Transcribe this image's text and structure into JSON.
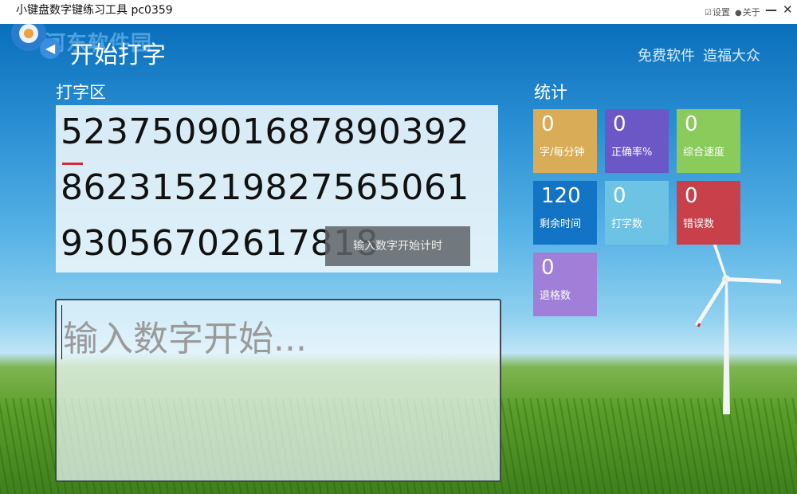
{
  "window": {
    "title": "小键盘数字键练习工具 pc0359",
    "settings_label": "设置",
    "about_label": "关于",
    "minimize_glyph": "—",
    "close_glyph": "✕"
  },
  "watermark": {
    "text": "河东软件园"
  },
  "header": {
    "back_icon": "arrow-left-icon",
    "title": "开始打字",
    "slogan_a": "免费软件",
    "slogan_b": "造福大众"
  },
  "typing_area": {
    "label": "打字区",
    "lines": [
      "5237509016878903​92",
      "862315219827565061",
      "930567026178​18"
    ],
    "tooltip": "输入数字开始计时"
  },
  "input": {
    "placeholder": "输入数字开始..."
  },
  "stats": {
    "label": "统计",
    "tiles": [
      {
        "value": "0",
        "label": "字/每分钟",
        "color": "#d9ad57"
      },
      {
        "value": "0",
        "label": "正确率%",
        "color": "#6c57c6"
      },
      {
        "value": "0",
        "label": "综合速度",
        "color": "#8acb5c"
      },
      {
        "value": "120",
        "label": "剩余时间",
        "color": "#1373c5"
      },
      {
        "value": "0",
        "label": "打字数",
        "color": "#6dc3e3"
      },
      {
        "value": "0",
        "label": "错误数",
        "color": "#c8404a"
      },
      {
        "value": "0",
        "label": "退格数",
        "color": "#a17fd8"
      }
    ]
  }
}
